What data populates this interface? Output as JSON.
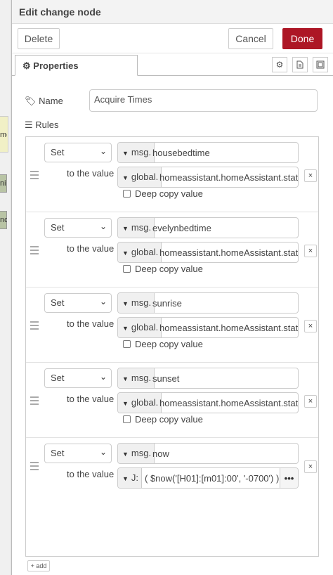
{
  "background": {
    "node_letters": [
      "me",
      "ni",
      "nc"
    ]
  },
  "header": {
    "title": "Edit change node"
  },
  "toolbar": {
    "delete_label": "Delete",
    "cancel_label": "Cancel",
    "done_label": "Done",
    "done_color": "#ad1625"
  },
  "tabs": {
    "properties_label": "Properties",
    "icons": [
      "gear-icon",
      "description-icon",
      "appearance-icon"
    ]
  },
  "form": {
    "name_label": "Name",
    "name_value": "Acquire Times",
    "rules_label": "Rules"
  },
  "rules": [
    {
      "action": "Set",
      "target_type": "msg.",
      "target_value": "housebedtime",
      "to_label": "to the value",
      "value_type": "global.",
      "value": "homeassistant.homeAssistant.states",
      "deep_copy_label": "Deep copy value",
      "remove": "×"
    },
    {
      "action": "Set",
      "target_type": "msg.",
      "target_value": "evelynbedtime",
      "to_label": "to the value",
      "value_type": "global.",
      "value": "homeassistant.homeAssistant.states",
      "deep_copy_label": "Deep copy value",
      "remove": "×"
    },
    {
      "action": "Set",
      "target_type": "msg.",
      "target_value": "sunrise",
      "to_label": "to the value",
      "value_type": "global.",
      "value": "homeassistant.homeAssistant.states",
      "deep_copy_label": "Deep copy value",
      "remove": "×"
    },
    {
      "action": "Set",
      "target_type": "msg.",
      "target_value": "sunset",
      "to_label": "to the value",
      "value_type": "global.",
      "value": "homeassistant.homeAssistant.states",
      "deep_copy_label": "Deep copy value",
      "remove": "×"
    },
    {
      "action": "Set",
      "target_type": "msg.",
      "target_value": "now",
      "to_label": "to the value",
      "value_type": "J:",
      "value": "( $now('[H01]:[m01]:00', '-0700') )",
      "expr_button": "•••",
      "remove": "×"
    }
  ],
  "footer": {
    "add_label": "+ add"
  }
}
